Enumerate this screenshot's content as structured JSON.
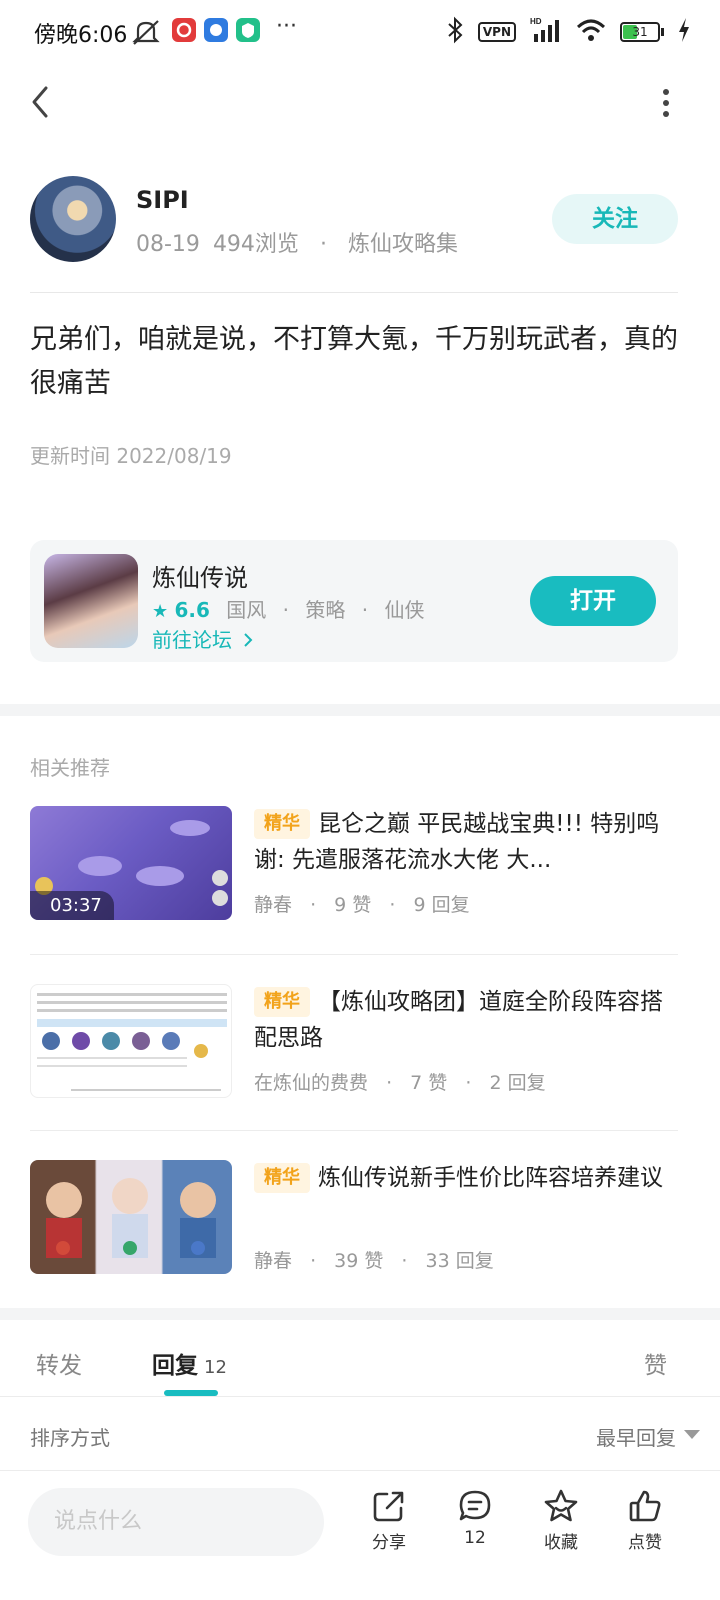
{
  "status_bar": {
    "time": "傍晚6:06",
    "more": "···",
    "vpn": "VPN",
    "hd": "HD",
    "battery": "31"
  },
  "author": {
    "name": "SIPI",
    "date": "08-19",
    "views": "494浏览",
    "separator": "·",
    "collection": "炼仙攻略集",
    "follow_label": "关注"
  },
  "post": {
    "body": "兄弟们，咱就是说，不打算大氪，千万别玩武者，真的很痛苦",
    "update_time": "更新时间 2022/08/19"
  },
  "game": {
    "name": "炼仙传说",
    "rating": "6.6",
    "tags": [
      "国风",
      "策略",
      "仙侠"
    ],
    "forum_link": "前往论坛",
    "open_label": "打开"
  },
  "recommend": {
    "title": "相关推荐",
    "items": [
      {
        "badge": "精华",
        "title": "昆仑之巅 平民越战宝典!!! 特别鸣谢: 先遣服落花流水大佬 大...",
        "author": "静春",
        "likes": "9 赞",
        "replies": "9 回复",
        "duration": "03:37"
      },
      {
        "badge": "精华",
        "title": "【炼仙攻略团】道庭全阶段阵容搭配思路",
        "author": "在炼仙的费费",
        "likes": "7 赞",
        "replies": "2 回复"
      },
      {
        "badge": "精华",
        "title": "炼仙传说新手性价比阵容培养建议",
        "author": "静春",
        "likes": "39 赞",
        "replies": "33 回复"
      }
    ]
  },
  "tabs": {
    "forward": "转发",
    "reply": "回复",
    "reply_count": "12",
    "like": "赞"
  },
  "sort": {
    "label": "排序方式",
    "value": "最早回复"
  },
  "bottom_bar": {
    "input_placeholder": "说点什么",
    "share": "分享",
    "comments": "12",
    "favorite": "收藏",
    "like": "点赞"
  },
  "colors": {
    "accent": "#19bcc0",
    "badge_text": "#f2a31b",
    "badge_bg": "#fff4e0"
  }
}
